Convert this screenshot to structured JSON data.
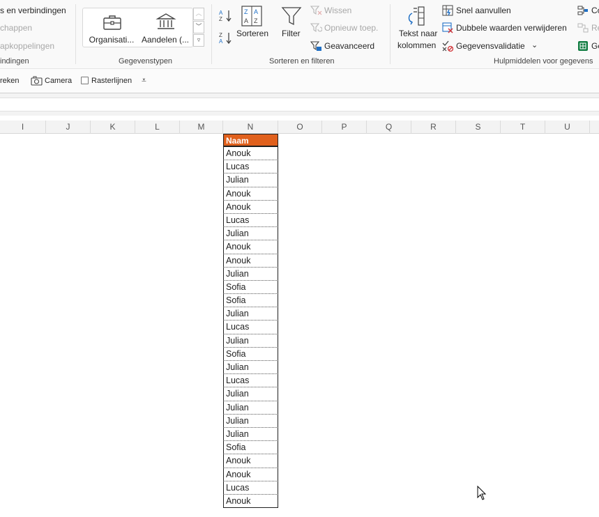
{
  "ribbon": {
    "queries_group": {
      "items": [
        "s en verbindingen",
        "chappen",
        "apkoppelingen"
      ],
      "label": "indingen"
    },
    "datatypes_group": {
      "items": [
        "Organisati...",
        "Aandelen (..."
      ],
      "label": "Gegevenstypen"
    },
    "sort_filter_group": {
      "sort_label": "Sorteren",
      "filter_label": "Filter",
      "clear_label": "Wissen",
      "reapply_label": "Opnieuw toep.",
      "advanced_label": "Geavanceerd",
      "label": "Sorteren en filteren"
    },
    "data_tools_group": {
      "text_to_columns_line1": "Tekst naar",
      "text_to_columns_line2": "kolommen",
      "flash_fill_label": "Snel aanvullen",
      "remove_duplicates_label": "Dubbele waarden verwijderen",
      "data_validation_label": "Gegevensvalidatie",
      "consolidate_label": "Co",
      "relationships_label": "Re",
      "manage_model_label": "Ge",
      "label": "Hulpmiddelen voor gegevens"
    }
  },
  "quick_access": {
    "first_label": "reken",
    "camera_label": "Camera",
    "gridlines_label": "Rasterlijnen"
  },
  "columns": [
    "I",
    "J",
    "K",
    "L",
    "M",
    "N",
    "O",
    "P",
    "Q",
    "R",
    "S",
    "T",
    "U"
  ],
  "table": {
    "header": "Naam",
    "rows": [
      "Anouk",
      "Lucas",
      "Julian",
      "Anouk",
      "Anouk",
      "Lucas",
      "Julian",
      "Anouk",
      "Anouk",
      "Julian",
      "Sofia",
      "Sofia",
      "Julian",
      "Lucas",
      "Julian",
      "Sofia",
      "Julian",
      "Lucas",
      "Julian",
      "Julian",
      "Julian",
      "Julian",
      "Sofia",
      "Anouk",
      "Anouk",
      "Lucas",
      "Anouk"
    ]
  },
  "colors": {
    "header_fill": "#e0601c",
    "accent_green": "#107c41"
  }
}
